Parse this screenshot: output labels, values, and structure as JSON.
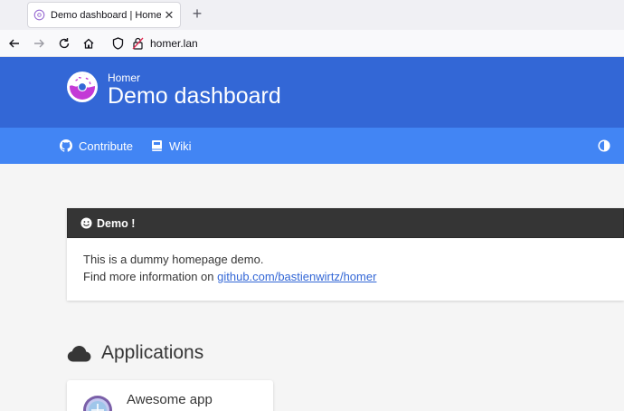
{
  "browser": {
    "tab_title": "Demo dashboard | Homer",
    "tab_close": "✕",
    "new_tab": "+",
    "url": "homer.lan"
  },
  "header": {
    "subtitle": "Homer",
    "title": "Demo dashboard",
    "brand_color": "#3367d6",
    "nav_color": "#4285f4"
  },
  "nav_links": [
    {
      "label": "Contribute",
      "icon": "github-icon"
    },
    {
      "label": "Wiki",
      "icon": "book-icon"
    }
  ],
  "message": {
    "title": "Demo !",
    "icon": "smile-icon",
    "line1": "This is a dummy homepage demo.",
    "line2_prefix": "Find more information on ",
    "link_text": "github.com/bastienwirtz/homer"
  },
  "group": {
    "title": "Applications",
    "icon": "cloud-icon"
  },
  "apps": [
    {
      "name": "Awesome app"
    }
  ]
}
